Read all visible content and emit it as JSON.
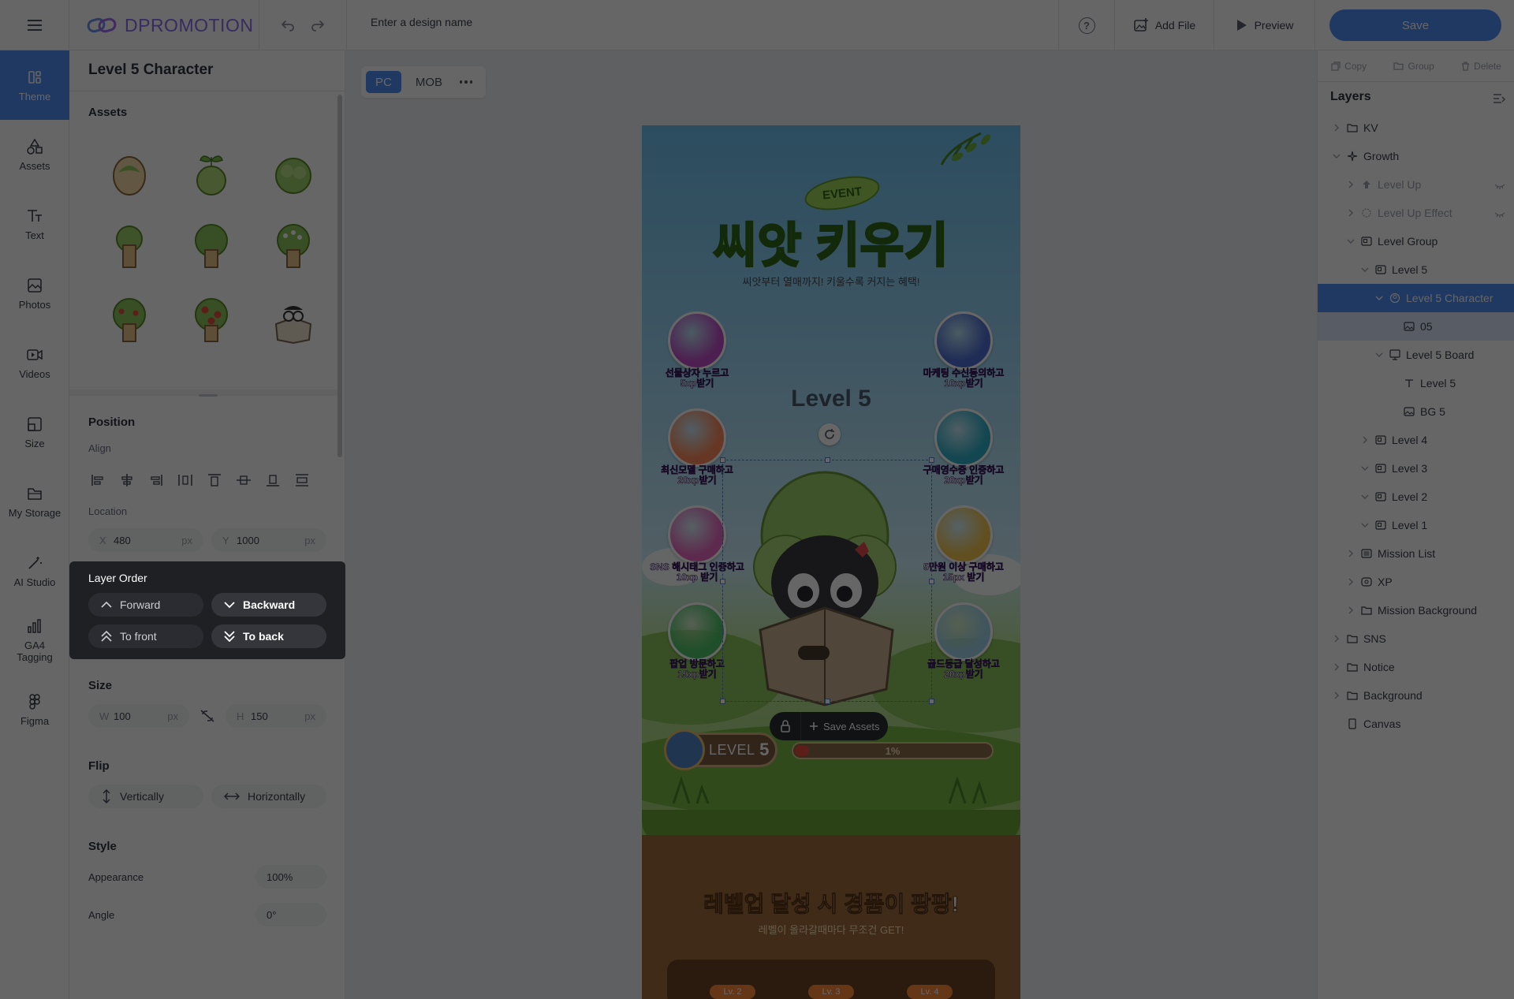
{
  "app": {
    "brand": "DPROMOTION",
    "design_name_placeholder": "Enter a design name",
    "help": "?",
    "add_file": "Add File",
    "preview": "Preview",
    "save": "Save",
    "accent": "#4f8ef7"
  },
  "nav": [
    {
      "label": "Theme",
      "icon": "theme-icon",
      "active": true
    },
    {
      "label": "Assets",
      "icon": "shapes-icon"
    },
    {
      "label": "Text",
      "icon": "text-icon"
    },
    {
      "label": "Photos",
      "icon": "image-icon"
    },
    {
      "label": "Videos",
      "icon": "video-icon"
    },
    {
      "label": "Size",
      "icon": "resize-icon"
    },
    {
      "label": "My Storage",
      "icon": "folder-icon"
    },
    {
      "label": "AI Studio",
      "icon": "magic-wand-icon"
    },
    {
      "label": "GA4 Tagging",
      "icon": "analytics-icon"
    },
    {
      "label": "Figma",
      "icon": "figma-icon"
    }
  ],
  "props": {
    "title": "Level 5 Character",
    "assets_heading": "Assets",
    "position_heading": "Position",
    "align_label": "Align",
    "location_label": "Location",
    "x_prefix": "X",
    "x_value": "480",
    "y_prefix": "Y",
    "y_value": "1000",
    "unit": "px",
    "layer_order": {
      "title": "Layer Order",
      "forward": "Forward",
      "backward": "Backward",
      "to_front": "To front",
      "to_back": "To back"
    },
    "size_heading": "Size",
    "w_prefix": "W",
    "w_value": "100",
    "h_prefix": "H",
    "h_value": "150",
    "flip_heading": "Flip",
    "flip_vertical": "Vertically",
    "flip_horizontal": "Horizontally",
    "style_heading": "Style",
    "appearance_label": "Appearance",
    "appearance_value": "100%",
    "angle_label": "Angle",
    "angle_value": "0°"
  },
  "canvas": {
    "device_pc": "PC",
    "device_mob": "MOB",
    "event_tag": "EVENT",
    "main_title": "씨앗 키우기",
    "subtitle": "씨앗부터 열매까지! 키울수록 커지는 혜택!",
    "missions": [
      {
        "caption": "선물상자 누르고\n5xp받기",
        "color": "#c04fc7"
      },
      {
        "caption": "마케팅 수신동의하고\n10xp받기",
        "color": "#4f6fd6"
      },
      {
        "caption": "최신모델 구매하고\n20xp받기",
        "color": "#ff8a5a"
      },
      {
        "caption": "구매영수증 인증하고\n20xp받기",
        "color": "#2fb0c9"
      },
      {
        "caption": "SNS 해시태그 인증하고\n10xp 받기",
        "color": "#e86ac0"
      },
      {
        "caption": "5만원 이상 구매하고\n15px 받기",
        "color": "#f2c64f"
      },
      {
        "caption": "팝업 방문하고\n15xp받기",
        "color": "#4fc56a"
      },
      {
        "caption": "골드등급 달성하고\n20xp받기",
        "color": "#9fd3e8"
      }
    ],
    "level_label": "Level 5",
    "save_assets": "Save Assets",
    "level_chip_prefix": "LEVEL",
    "level_chip_number": "5",
    "xp_percent": "1%",
    "xp_progress": 0.06,
    "reward_highlight": "레벨업",
    "reward_rest": " 달성 시 경품이 팡팡!",
    "reward_sub": "레벨이 올라갈때마다 무조건 GET!",
    "tiers": [
      "Lv. 2",
      "Lv. 3",
      "Lv. 4"
    ]
  },
  "layers": {
    "actions": [
      "Copy",
      "Group",
      "Delete"
    ],
    "title": "Layers",
    "items": [
      {
        "label": "KV",
        "icon": "folder-icon",
        "chev": "right",
        "faded": false,
        "indent": 0
      },
      {
        "label": "Growth",
        "icon": "sparkle-icon",
        "chev": "down",
        "faded": false,
        "indent": 0
      },
      {
        "label": "Level Up",
        "icon": "upload-icon",
        "chev": "right",
        "faded": true,
        "indent": 1,
        "hidden": true
      },
      {
        "label": "Level Up Effect",
        "icon": "effect-icon",
        "chev": "right",
        "faded": true,
        "indent": 1,
        "hidden": true
      },
      {
        "label": "Level Group",
        "icon": "group-icon",
        "chev": "down",
        "faded": false,
        "indent": 1
      },
      {
        "label": "Level 5",
        "icon": "group-icon",
        "chev": "down",
        "faded": false,
        "indent": 2
      },
      {
        "label": "Level 5 Character",
        "icon": "character-icon",
        "chev": "down",
        "faded": false,
        "indent": 3,
        "selected": true
      },
      {
        "label": "05",
        "icon": "image-icon",
        "chev": "",
        "faded": false,
        "indent": 4,
        "child_sel": true
      },
      {
        "label": "Level 5 Board",
        "icon": "board-icon",
        "chev": "down",
        "faded": false,
        "indent": 3
      },
      {
        "label": "Level 5",
        "icon": "text-icon",
        "chev": "",
        "faded": false,
        "indent": 4
      },
      {
        "label": "BG 5",
        "icon": "image-icon",
        "chev": "",
        "faded": false,
        "indent": 4
      },
      {
        "label": "Level 4",
        "icon": "group-icon",
        "chev": "right",
        "faded": false,
        "indent": 2
      },
      {
        "label": "Level 3",
        "icon": "group-icon",
        "chev": "down",
        "faded": false,
        "indent": 2
      },
      {
        "label": "Level 2",
        "icon": "group-icon",
        "chev": "down",
        "faded": false,
        "indent": 2
      },
      {
        "label": "Level 1",
        "icon": "group-icon",
        "chev": "down",
        "faded": false,
        "indent": 2
      },
      {
        "label": "Mission List",
        "icon": "list-icon",
        "chev": "right",
        "faded": false,
        "indent": 1
      },
      {
        "label": "XP",
        "icon": "xp-icon",
        "chev": "right",
        "faded": false,
        "indent": 1
      },
      {
        "label": "Mission Background",
        "icon": "folder-icon",
        "chev": "right",
        "faded": false,
        "indent": 1
      },
      {
        "label": "SNS",
        "icon": "folder-icon",
        "chev": "right",
        "faded": false,
        "indent": 0
      },
      {
        "label": "Notice",
        "icon": "folder-icon",
        "chev": "right",
        "faded": false,
        "indent": 0
      },
      {
        "label": "Background",
        "icon": "folder-icon",
        "chev": "right",
        "faded": false,
        "indent": 0
      },
      {
        "label": "Canvas",
        "icon": "canvas-icon",
        "chev": "",
        "faded": false,
        "indent": 0
      }
    ]
  }
}
